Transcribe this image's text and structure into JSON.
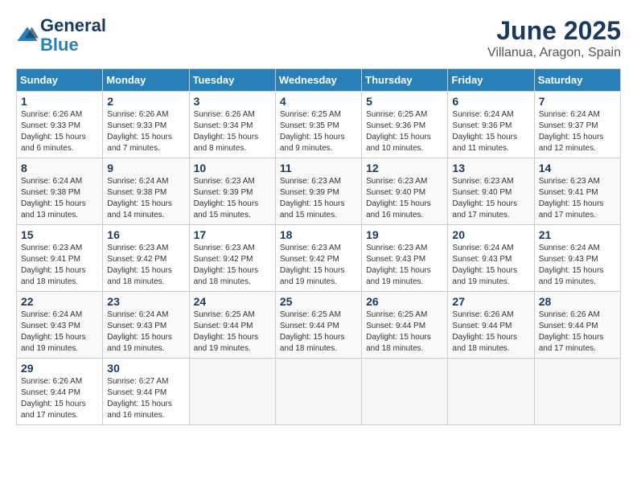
{
  "header": {
    "logo": {
      "line1": "General",
      "line2": "Blue"
    },
    "title": "June 2025",
    "location": "Villanua, Aragon, Spain"
  },
  "weekdays": [
    "Sunday",
    "Monday",
    "Tuesday",
    "Wednesday",
    "Thursday",
    "Friday",
    "Saturday"
  ],
  "weeks": [
    [
      {
        "day": "1",
        "sunrise": "6:26 AM",
        "sunset": "9:33 PM",
        "daylight": "15 hours and 6 minutes."
      },
      {
        "day": "2",
        "sunrise": "6:26 AM",
        "sunset": "9:33 PM",
        "daylight": "15 hours and 7 minutes."
      },
      {
        "day": "3",
        "sunrise": "6:26 AM",
        "sunset": "9:34 PM",
        "daylight": "15 hours and 8 minutes."
      },
      {
        "day": "4",
        "sunrise": "6:25 AM",
        "sunset": "9:35 PM",
        "daylight": "15 hours and 9 minutes."
      },
      {
        "day": "5",
        "sunrise": "6:25 AM",
        "sunset": "9:36 PM",
        "daylight": "15 hours and 10 minutes."
      },
      {
        "day": "6",
        "sunrise": "6:24 AM",
        "sunset": "9:36 PM",
        "daylight": "15 hours and 11 minutes."
      },
      {
        "day": "7",
        "sunrise": "6:24 AM",
        "sunset": "9:37 PM",
        "daylight": "15 hours and 12 minutes."
      }
    ],
    [
      {
        "day": "8",
        "sunrise": "6:24 AM",
        "sunset": "9:38 PM",
        "daylight": "15 hours and 13 minutes."
      },
      {
        "day": "9",
        "sunrise": "6:24 AM",
        "sunset": "9:38 PM",
        "daylight": "15 hours and 14 minutes."
      },
      {
        "day": "10",
        "sunrise": "6:23 AM",
        "sunset": "9:39 PM",
        "daylight": "15 hours and 15 minutes."
      },
      {
        "day": "11",
        "sunrise": "6:23 AM",
        "sunset": "9:39 PM",
        "daylight": "15 hours and 15 minutes."
      },
      {
        "day": "12",
        "sunrise": "6:23 AM",
        "sunset": "9:40 PM",
        "daylight": "15 hours and 16 minutes."
      },
      {
        "day": "13",
        "sunrise": "6:23 AM",
        "sunset": "9:40 PM",
        "daylight": "15 hours and 17 minutes."
      },
      {
        "day": "14",
        "sunrise": "6:23 AM",
        "sunset": "9:41 PM",
        "daylight": "15 hours and 17 minutes."
      }
    ],
    [
      {
        "day": "15",
        "sunrise": "6:23 AM",
        "sunset": "9:41 PM",
        "daylight": "15 hours and 18 minutes."
      },
      {
        "day": "16",
        "sunrise": "6:23 AM",
        "sunset": "9:42 PM",
        "daylight": "15 hours and 18 minutes."
      },
      {
        "day": "17",
        "sunrise": "6:23 AM",
        "sunset": "9:42 PM",
        "daylight": "15 hours and 18 minutes."
      },
      {
        "day": "18",
        "sunrise": "6:23 AM",
        "sunset": "9:42 PM",
        "daylight": "15 hours and 19 minutes."
      },
      {
        "day": "19",
        "sunrise": "6:23 AM",
        "sunset": "9:43 PM",
        "daylight": "15 hours and 19 minutes."
      },
      {
        "day": "20",
        "sunrise": "6:24 AM",
        "sunset": "9:43 PM",
        "daylight": "15 hours and 19 minutes."
      },
      {
        "day": "21",
        "sunrise": "6:24 AM",
        "sunset": "9:43 PM",
        "daylight": "15 hours and 19 minutes."
      }
    ],
    [
      {
        "day": "22",
        "sunrise": "6:24 AM",
        "sunset": "9:43 PM",
        "daylight": "15 hours and 19 minutes."
      },
      {
        "day": "23",
        "sunrise": "6:24 AM",
        "sunset": "9:43 PM",
        "daylight": "15 hours and 19 minutes."
      },
      {
        "day": "24",
        "sunrise": "6:25 AM",
        "sunset": "9:44 PM",
        "daylight": "15 hours and 19 minutes."
      },
      {
        "day": "25",
        "sunrise": "6:25 AM",
        "sunset": "9:44 PM",
        "daylight": "15 hours and 18 minutes."
      },
      {
        "day": "26",
        "sunrise": "6:25 AM",
        "sunset": "9:44 PM",
        "daylight": "15 hours and 18 minutes."
      },
      {
        "day": "27",
        "sunrise": "6:26 AM",
        "sunset": "9:44 PM",
        "daylight": "15 hours and 18 minutes."
      },
      {
        "day": "28",
        "sunrise": "6:26 AM",
        "sunset": "9:44 PM",
        "daylight": "15 hours and 17 minutes."
      }
    ],
    [
      {
        "day": "29",
        "sunrise": "6:26 AM",
        "sunset": "9:44 PM",
        "daylight": "15 hours and 17 minutes."
      },
      {
        "day": "30",
        "sunrise": "6:27 AM",
        "sunset": "9:44 PM",
        "daylight": "15 hours and 16 minutes."
      },
      null,
      null,
      null,
      null,
      null
    ]
  ]
}
